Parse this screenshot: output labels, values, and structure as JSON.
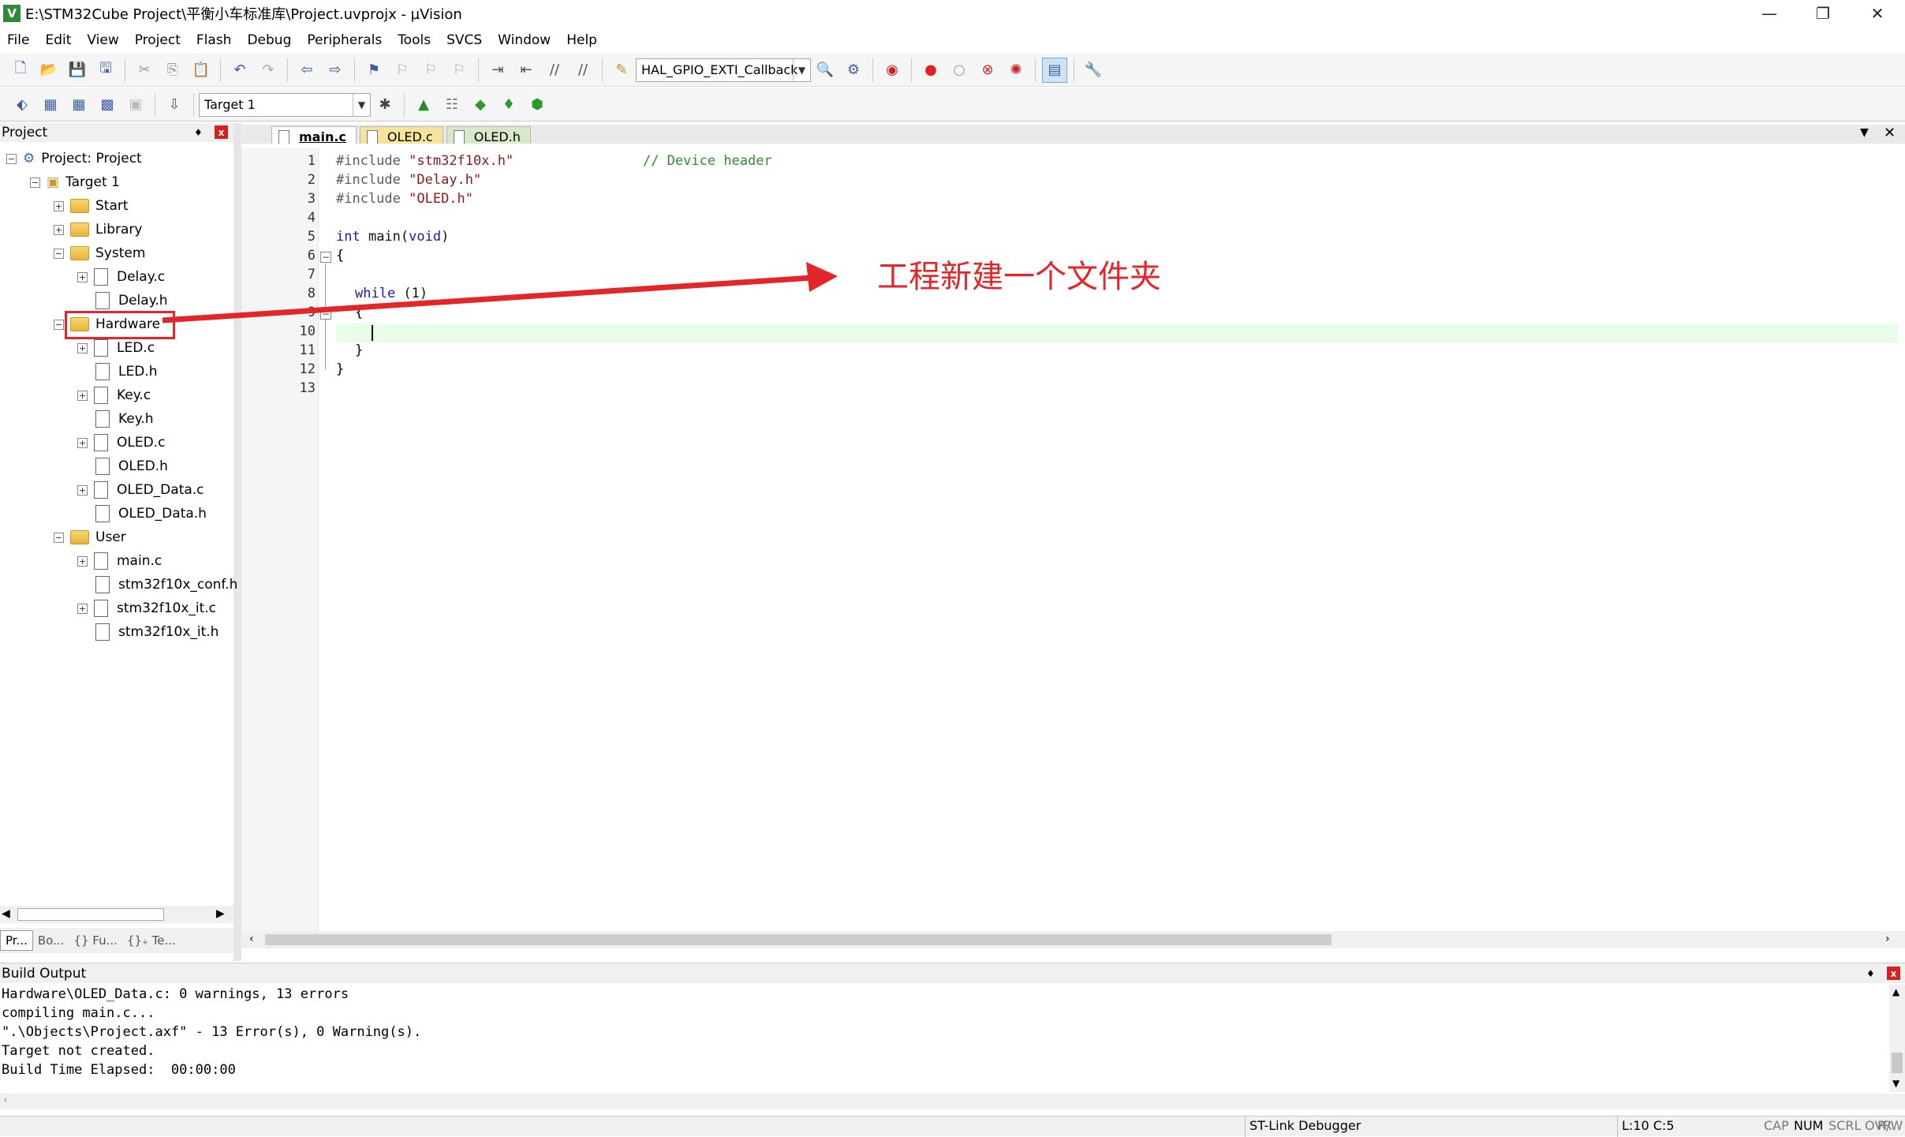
{
  "window": {
    "title": "E:\\STM32Cube Project\\平衡小车标准库\\Project.uvprojx - µVision",
    "min": "—",
    "max": "❐",
    "close": "✕",
    "app_icon": "V"
  },
  "menu": [
    "File",
    "Edit",
    "View",
    "Project",
    "Flash",
    "Debug",
    "Peripherals",
    "Tools",
    "SVCS",
    "Window",
    "Help"
  ],
  "toolbar": {
    "function_combo": "HAL_GPIO_EXTI_Callback",
    "target_combo": "Target 1"
  },
  "project_panel": {
    "title": "Project",
    "pin": "♦",
    "close": "x",
    "root": "Project: Project",
    "target": "Target 1",
    "groups": [
      "Start",
      "Library",
      "System",
      "Hardware",
      "User"
    ],
    "system_files": [
      "Delay.c",
      "Delay.h"
    ],
    "hardware_files": [
      "LED.c",
      "LED.h",
      "Key.c",
      "Key.h",
      "OLED.c",
      "OLED.h",
      "OLED_Data.c",
      "OLED_Data.h"
    ],
    "user_files": [
      "main.c",
      "stm32f10x_conf.h",
      "stm32f10x_it.c",
      "stm32f10x_it.h"
    ],
    "bottom_tabs": [
      "Pr...",
      "Bo...",
      "{} Fu...",
      "{}₊ Te..."
    ]
  },
  "editor": {
    "tabs": [
      "main.c",
      "OLED.c",
      "OLED.h"
    ],
    "line_numbers": [
      "1",
      "2",
      "3",
      "4",
      "5",
      "6",
      "7",
      "8",
      "9",
      "10",
      "11",
      "12",
      "13"
    ],
    "code": {
      "l1a": "#include",
      "l1b": "\"stm32f10x.h\"",
      "l1c": "// Device header",
      "l2a": "#include",
      "l2b": "\"Delay.h\"",
      "l3a": "#include",
      "l3b": "\"OLED.h\"",
      "l5a": "int",
      "l5b": " main(",
      "l5c": "void",
      "l5d": ")",
      "l6": "{",
      "l8a": "while",
      "l8b": " (1)",
      "l9": "{",
      "l11": "}",
      "l12": "}"
    },
    "cursor": "L:10 C:5"
  },
  "annotation": "工程新建一个文件夹",
  "build_output": {
    "title": "Build Output",
    "lines": [
      "Hardware\\OLED_Data.c: 0 warnings, 13 errors",
      "compiling main.c...",
      "\".\\Objects\\Project.axf\" - 13 Error(s), 0 Warning(s).",
      "Target not created.",
      "Build Time Elapsed:  00:00:00"
    ]
  },
  "status": {
    "debugger": "ST-Link Debugger",
    "position": "L:10 C:5",
    "cap": "CAP",
    "num": "NUM",
    "scrl": "SCRL",
    "ovr": "OVR",
    "rw": "R/W"
  }
}
